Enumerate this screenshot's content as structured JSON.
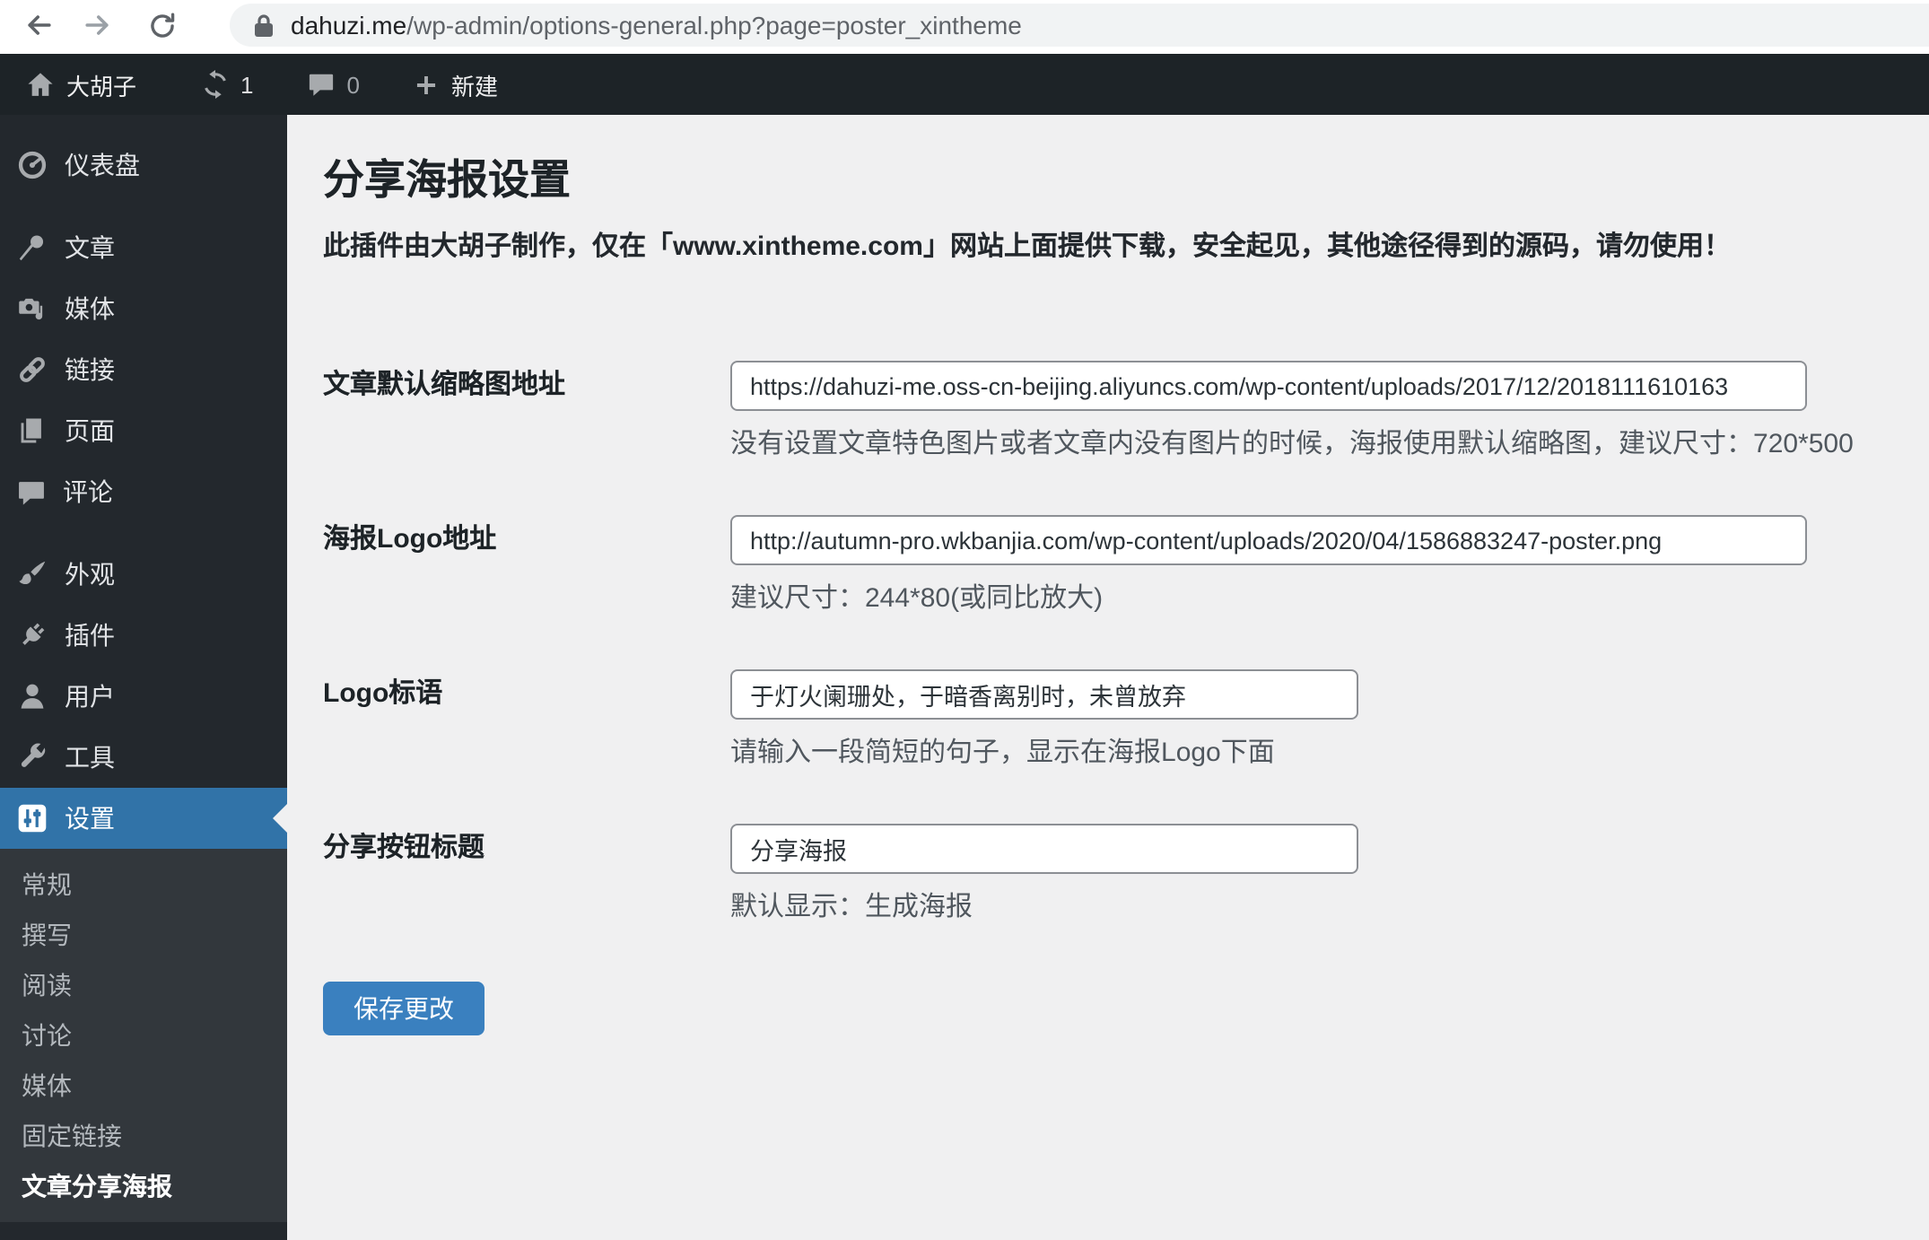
{
  "browser": {
    "url_host": "dahuzi.me",
    "url_path": "/wp-admin/options-general.php?page=poster_xintheme"
  },
  "admin_bar": {
    "site_name": "大胡子",
    "update_count": "1",
    "comment_count": "0",
    "new_label": "新建"
  },
  "sidebar": {
    "items": [
      "仪表盘",
      "文章",
      "媒体",
      "链接",
      "页面",
      "评论",
      "外观",
      "插件",
      "用户",
      "工具",
      "设置"
    ],
    "settings_submenu": [
      "常规",
      "撰写",
      "阅读",
      "讨论",
      "媒体",
      "固定链接",
      "文章分享海报"
    ],
    "current_item": "设置",
    "current_submenu_item": "文章分享海报"
  },
  "main": {
    "title": "分享海报设置",
    "notice": "此插件由大胡子制作，仅在「www.xintheme.com」网站上面提供下载，安全起见，其他途径得到的源码，请勿使用！",
    "fields": [
      {
        "label": "文章默认缩略图地址",
        "value": "https://dahuzi-me.oss-cn-beijing.aliyuncs.com/wp-content/uploads/2017/12/2018111610163",
        "help": "没有设置文章特色图片或者文章内没有图片的时候，海报使用默认缩略图，建议尺寸：720*500"
      },
      {
        "label": "海报Logo地址",
        "value": "http://autumn-pro.wkbanjia.com/wp-content/uploads/2020/04/1586883247-poster.png",
        "help": "建议尺寸：244*80(或同比放大)"
      },
      {
        "label": "Logo标语",
        "value": "于灯火阑珊处，于暗香离别时，未曾放弃",
        "help": "请输入一段简短的句子，显示在海报Logo下面"
      },
      {
        "label": "分享按钮标题",
        "value": "分享海报",
        "help": "默认显示：生成海报"
      }
    ],
    "save_button": "保存更改"
  },
  "colors": {
    "adminbar_bg": "#1d2327",
    "sidebar_bg": "#23282d",
    "submenu_bg": "#32373c",
    "menu_accent_blue": "#3173a8",
    "button_blue": "#3a80bf",
    "content_bg": "#f0f0f1"
  }
}
